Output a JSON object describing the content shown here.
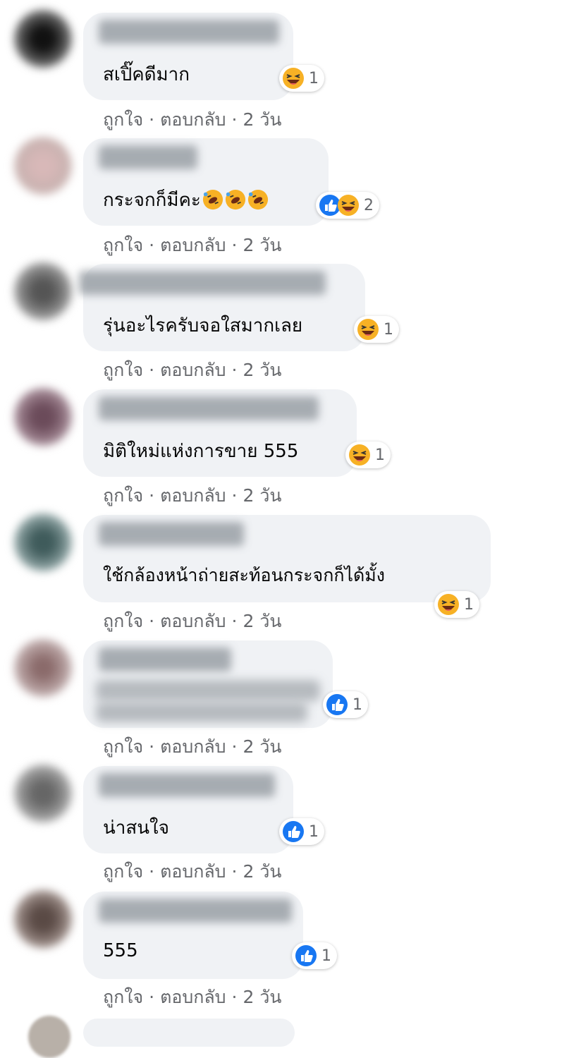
{
  "actions": {
    "like": "ถูกใจ",
    "reply": "ตอบกลับ",
    "separator": "·"
  },
  "comments": [
    {
      "text": "สเปิ๊คดีมาก",
      "time": "2 วัน",
      "count": "1"
    },
    {
      "text": "กระจกก็มีคะ",
      "time": "2 วัน",
      "count": "2"
    },
    {
      "text": "รุ่นอะไรครับจอใสมากเลย",
      "time": "2 วัน",
      "count": "1"
    },
    {
      "text": "มิติใหม่แห่งการขาย 555",
      "time": "2 วัน",
      "count": "1"
    },
    {
      "text": "ใช้กล้องหน้าถ่ายสะท้อนกระจกก็ได้มั้ง",
      "time": "2 วัน",
      "count": "1"
    },
    {
      "text": "",
      "time": "2 วัน",
      "count": "1"
    },
    {
      "text": "น่าสนใจ",
      "time": "2 วัน",
      "count": "1"
    },
    {
      "text": "555",
      "time": "2 วัน",
      "count": "1"
    }
  ],
  "colors": {
    "bubble": "#f0f2f5",
    "like_blue": "#1877f2",
    "haha_yellow": "#f7b125",
    "meta_text": "#65676b"
  },
  "icons": {
    "like": "thumbs-up-icon",
    "haha": "laughing-emoji-icon",
    "rofl": "rolling-laughing-emoji-icon"
  }
}
